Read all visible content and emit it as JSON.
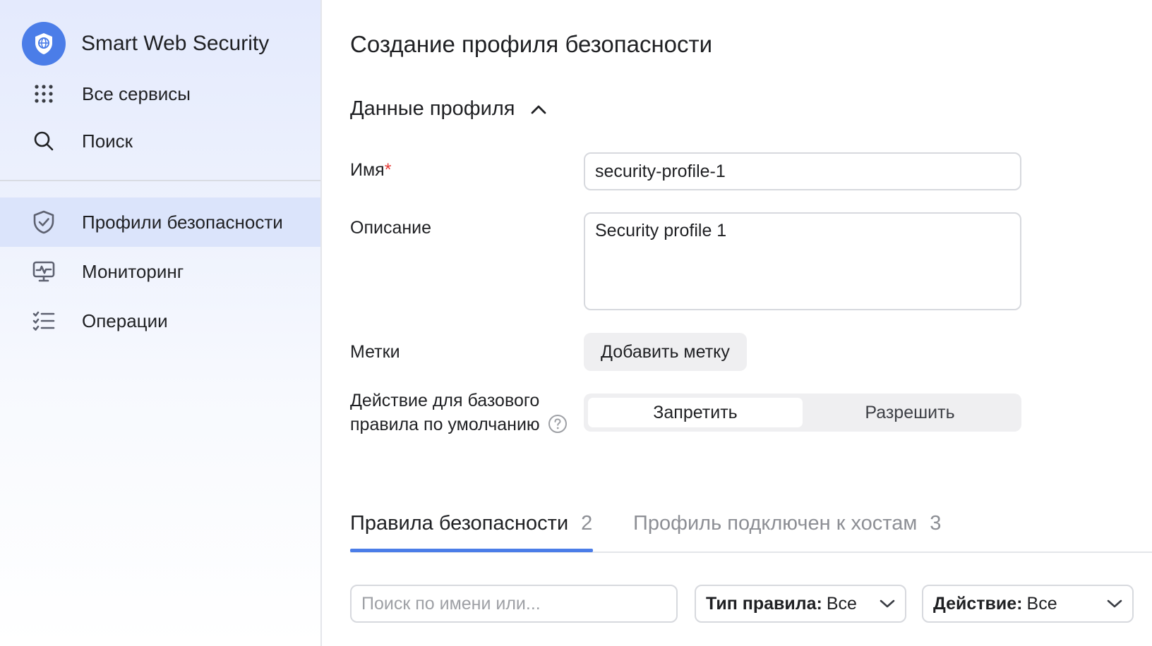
{
  "sidebar": {
    "brand": {
      "title": "Smart Web Security",
      "icon": "shield-globe-icon"
    },
    "top_items": [
      {
        "label": "Все сервисы",
        "icon": "grid-dots-icon"
      },
      {
        "label": "Поиск",
        "icon": "search-icon"
      }
    ],
    "items": [
      {
        "label": "Профили безопасности",
        "icon": "shield-check-icon",
        "active": true
      },
      {
        "label": "Мониторинг",
        "icon": "monitor-pulse-icon",
        "active": false
      },
      {
        "label": "Операции",
        "icon": "checklist-icon",
        "active": false
      }
    ]
  },
  "main": {
    "title": "Создание профиля безопасности",
    "section": {
      "title": "Данные профиля",
      "expanded": true
    },
    "form": {
      "name": {
        "label": "Имя",
        "required_mark": "*",
        "value": "security-profile-1"
      },
      "description": {
        "label": "Описание",
        "value": "Security profile 1"
      },
      "tags": {
        "label": "Метки",
        "button": "Добавить метку"
      },
      "default_action": {
        "label_line1": "Действие для базового",
        "label_line2": "правила по умолчанию",
        "options": [
          "Запретить",
          "Разрешить"
        ],
        "selected": "Запретить"
      }
    },
    "tabs": [
      {
        "label": "Правила безопасности",
        "count": "2",
        "active": true
      },
      {
        "label": "Профиль подключен к хостам",
        "count": "3",
        "active": false
      }
    ],
    "filters": {
      "search_placeholder": "Поиск по имени или...",
      "rule_type": {
        "key": "Тип правила:",
        "value": "Все"
      },
      "action": {
        "key": "Действие:",
        "value": "Все"
      }
    }
  },
  "colors": {
    "accent": "#4b7de8",
    "required": "#e53935",
    "active_nav_bg": "#dbe4fb"
  }
}
